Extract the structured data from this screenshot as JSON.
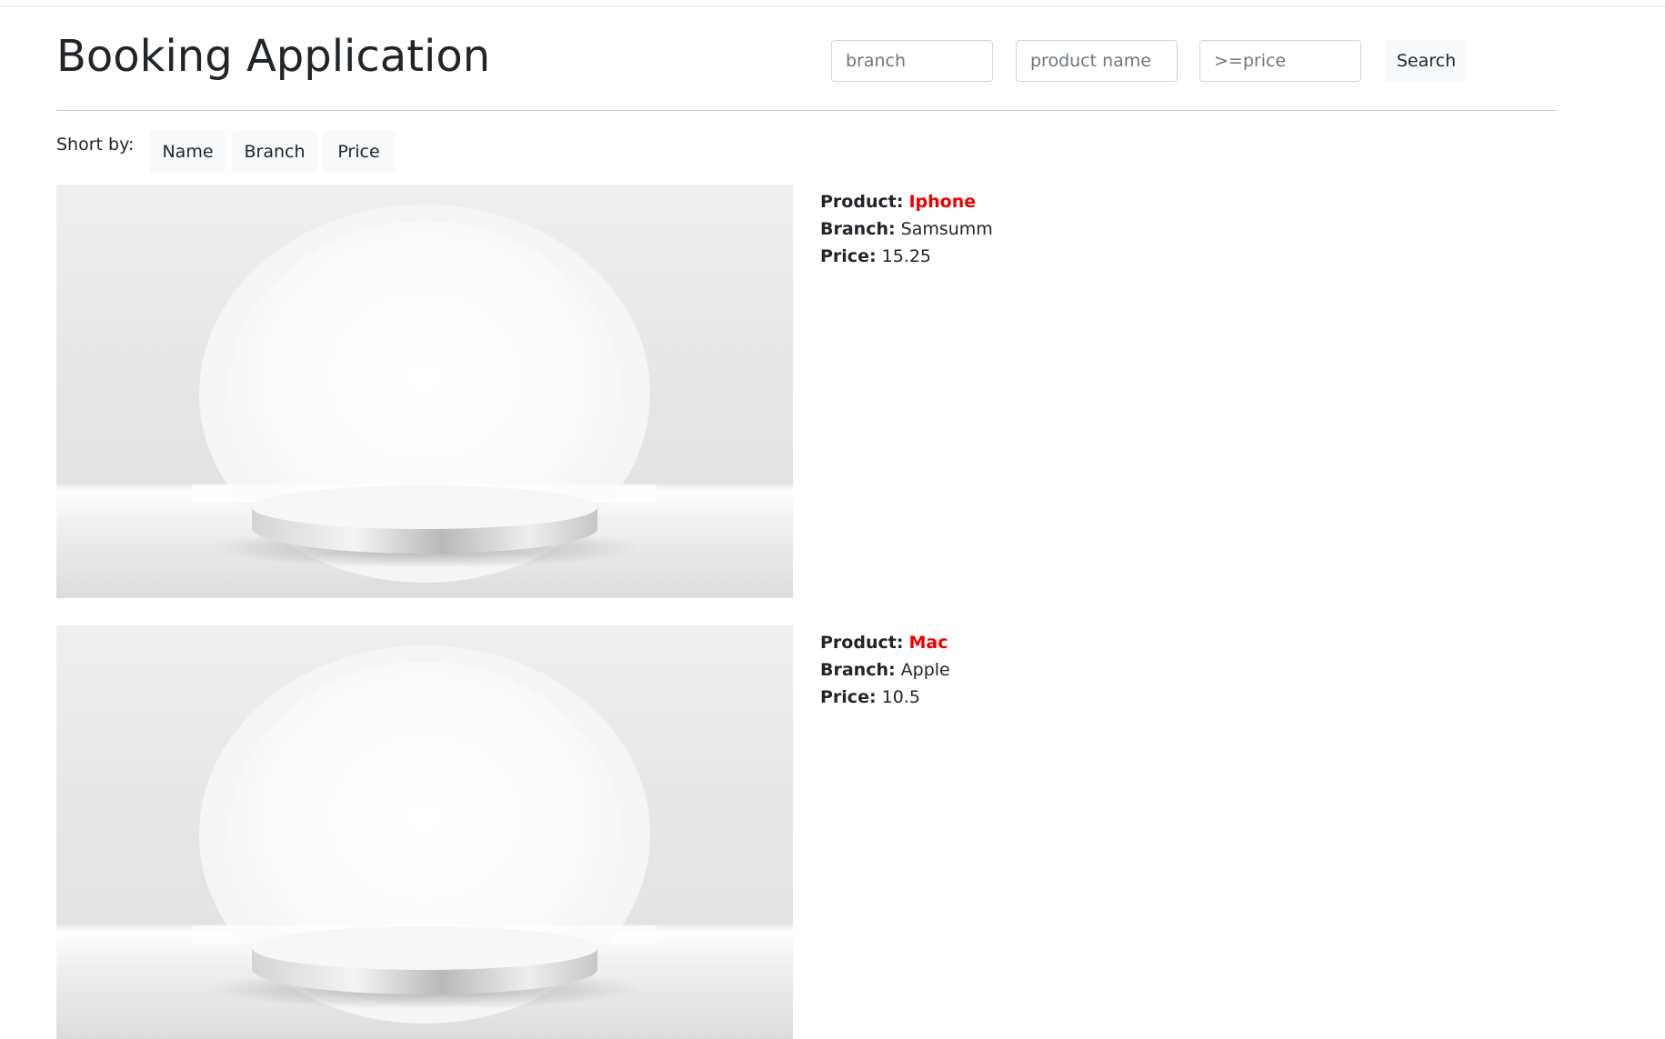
{
  "app": {
    "title": "Booking Application"
  },
  "search": {
    "branch_placeholder": "branch",
    "product_placeholder": "product name",
    "price_placeholder": ">=price",
    "button_label": "Search"
  },
  "sort": {
    "label": "Short by:",
    "options": [
      "Name",
      "Branch",
      "Price"
    ]
  },
  "labels": {
    "product": "Product:",
    "branch": "Branch:",
    "price": "Price:"
  },
  "products": [
    {
      "name": "Iphone",
      "branch": "Samsumm",
      "price": "15.25"
    },
    {
      "name": "Mac",
      "branch": "Apple",
      "price": "10.5"
    }
  ],
  "colors": {
    "product_name": "#ee0000",
    "button_bg": "#f8f9fa",
    "input_border": "#ced4da",
    "text": "#212529"
  }
}
